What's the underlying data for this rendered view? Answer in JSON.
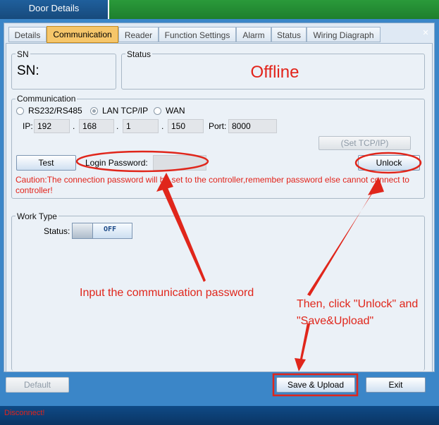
{
  "window": {
    "title": "Door Details",
    "close_glyph": "✕"
  },
  "tabs": [
    {
      "label": "Details"
    },
    {
      "label": "Communication"
    },
    {
      "label": "Reader"
    },
    {
      "label": "Function Settings"
    },
    {
      "label": "Alarm"
    },
    {
      "label": "Status"
    },
    {
      "label": "Wiring Diagraph"
    }
  ],
  "sn": {
    "group_label": "SN",
    "value": "SN:"
  },
  "status": {
    "group_label": "Status",
    "value": "Offline"
  },
  "communication": {
    "group_label": "Communication",
    "options": [
      "RS232/RS485",
      "LAN TCP/IP",
      "WAN"
    ],
    "selected": "LAN TCP/IP",
    "ip_label": "IP:",
    "ip": [
      "192",
      "168",
      "1",
      "150"
    ],
    "dot": ".",
    "port_label": "Port:",
    "port": "8000",
    "set_tcpip_label": "(Set TCP/IP)",
    "test_label": "Test",
    "password_label": "Login Password:",
    "password_value": "",
    "unlock_label": "Unlock",
    "caution": "Caution:The connection password will be set to the controller,remember password else cannot connect to controller!"
  },
  "work_type": {
    "group_label": "Work Type",
    "status_label": "Status:",
    "toggle_state": "OFF"
  },
  "annotations": {
    "input_password": "Input the communication password",
    "then_click": "Then, click \"Unlock\" and \"Save&Upload\""
  },
  "footer": {
    "default_label": "Default",
    "save_label": "Save & Upload",
    "exit_label": "Exit"
  },
  "statusbar": {
    "text": "Disconnect!"
  },
  "colors": {
    "annotation_red": "#e0261b",
    "active_tab": "#f6c66a",
    "title_green": "#1e7f2d"
  }
}
